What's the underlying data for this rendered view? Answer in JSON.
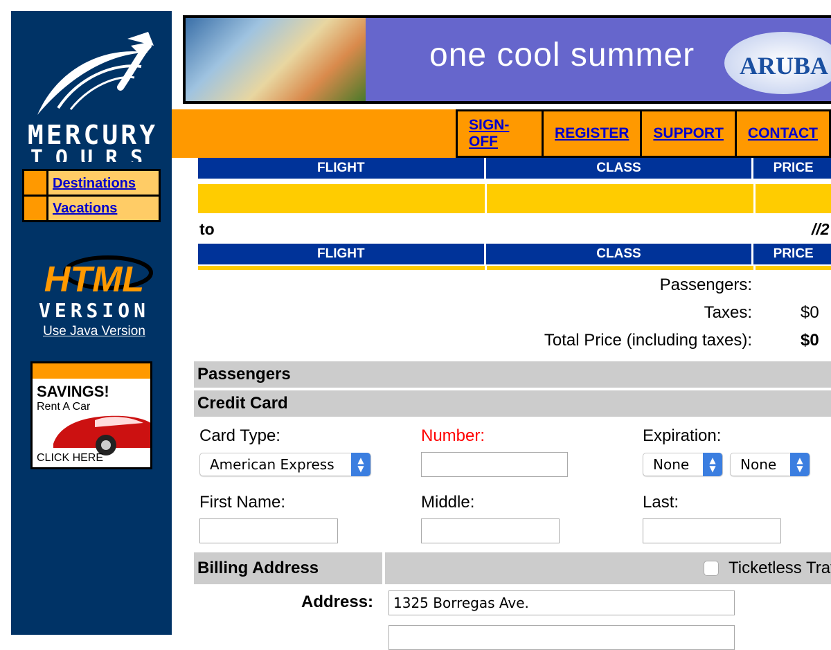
{
  "brand": {
    "line1": "MERCURY",
    "line2": "TOURS"
  },
  "sidebar": {
    "nav_items": [
      {
        "label": "Destinations"
      },
      {
        "label": "Vacations"
      }
    ],
    "html_version": {
      "line1": "HTML",
      "line2": "VERSION"
    },
    "java_link": "Use Java Version",
    "ad": {
      "title": "SAVINGS!",
      "subtitle": "Rent A Car",
      "cta": "CLICK HERE"
    }
  },
  "banner": {
    "text": "one cool summer",
    "logo_text": "ARUBA"
  },
  "topnav": {
    "links": [
      {
        "label": "SIGN-OFF"
      },
      {
        "label": "REGISTER"
      },
      {
        "label": "SUPPORT"
      },
      {
        "label": "CONTACT"
      }
    ]
  },
  "itinerary": {
    "columns": [
      "FLIGHT",
      "CLASS",
      "PRICE"
    ],
    "return_label": "to",
    "return_date": "//2"
  },
  "summary": {
    "passengers_label": "Passengers:",
    "passengers_value": "",
    "taxes_label": "Taxes:",
    "taxes_value": "$0",
    "total_label": "Total Price (including taxes):",
    "total_value": "$0"
  },
  "sections": {
    "passengers": "Passengers",
    "credit_card": "Credit Card",
    "billing_address": "Billing Address"
  },
  "credit_card": {
    "card_type_label": "Card Type:",
    "card_type_value": "American Express",
    "number_label": "Number:",
    "number_value": "",
    "expiration_label": "Expiration:",
    "exp_month_value": "None",
    "exp_year_value": "None",
    "first_name_label": "First Name:",
    "middle_label": "Middle:",
    "last_label": "Last:"
  },
  "billing": {
    "ticketless_label": "Ticketless Travel",
    "address_label": "Address:",
    "address_value": "1325 Borregas Ave.",
    "address2_value": ""
  },
  "colors": {
    "sidebar_bg": "#003366",
    "accent_orange": "#ff9900",
    "header_blue": "#003399",
    "row_yellow": "#ffcc00",
    "section_gray": "#cccccc",
    "link_blue": "#0000cc",
    "required_red": "#ff0000"
  },
  "icons": [
    "plane-logo-icon",
    "select-chevron-icon",
    "car-icon"
  ]
}
